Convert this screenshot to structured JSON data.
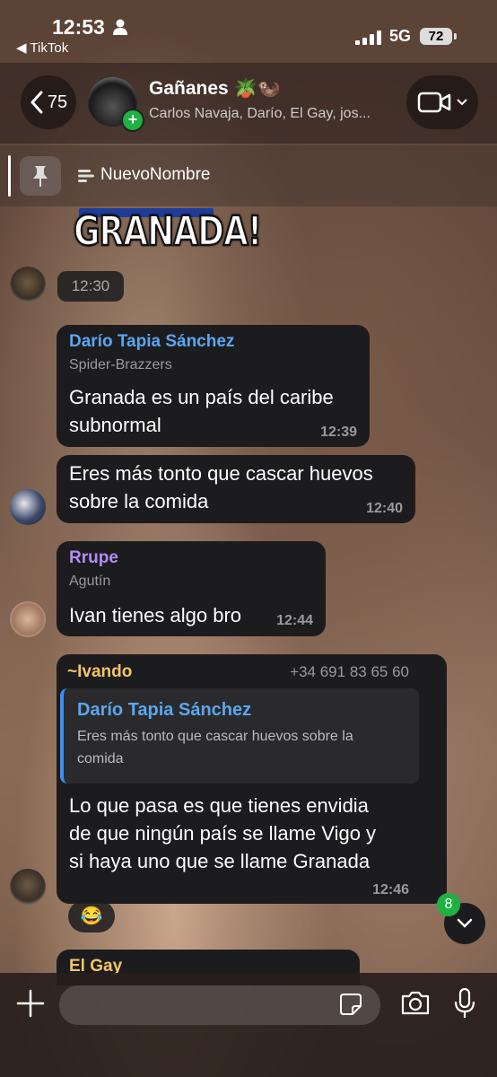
{
  "status_bar": {
    "time": "12:53",
    "back_app": "◀ TikTok",
    "network": "5G",
    "battery": "72"
  },
  "header": {
    "back_count": "75",
    "group_name": "Gañanes 🪴🦦",
    "members": "Carlos Navaja, Darío, El Gay, jos..."
  },
  "pinned": {
    "label": "NuevoNombre"
  },
  "sticker": {
    "text": "GRANADA!"
  },
  "time_chip": "12:30",
  "messages": [
    {
      "sender": "Darío Tapia Sánchez",
      "sender_color": "#5aa7f0",
      "subtitle": "Spider-Brazzers",
      "text_lines": [
        "Granada es un país del caribe",
        "subnormal"
      ],
      "time": "12:39"
    },
    {
      "text_lines": [
        "Eres más tonto que cascar huevos",
        "sobre la comida"
      ],
      "time": "12:40"
    },
    {
      "sender": "Rrupe",
      "sender_color": "#b38cf5",
      "subtitle": "Agutín",
      "text_lines": [
        "Ivan tienes algo bro"
      ],
      "time": "12:44"
    },
    {
      "sender": "~Ivando",
      "sender_color": "#f3c46a",
      "phone": "+34 691 83 65 60",
      "quote_sender": "Darío Tapia Sánchez",
      "quote_text_lines": [
        "Eres más tonto que cascar huevos sobre la",
        "comida"
      ],
      "text_lines": [
        "Lo que pasa es que tienes envidia",
        "de que ningún país se llame Vigo y",
        "si haya uno que se llame Granada"
      ],
      "time": "12:46",
      "reaction": "😂"
    },
    {
      "sender": "El Gay",
      "sender_color": "#f3c46a"
    }
  ],
  "unread_count": "8"
}
